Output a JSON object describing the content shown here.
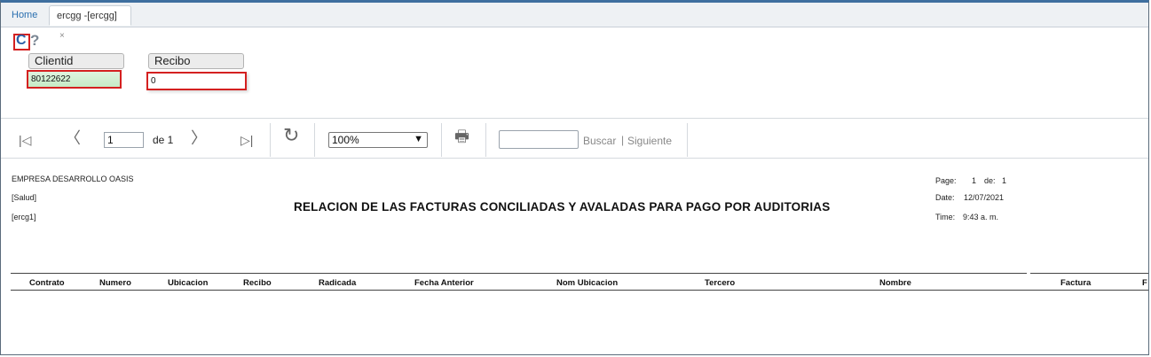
{
  "tabs": {
    "home": "Home",
    "active": "ercgg -[ercgg]",
    "close": "×"
  },
  "icons": {
    "refresh": "refresh-icon",
    "help": "help-icon"
  },
  "params": {
    "clientid_label": "Clientid",
    "clientid_value": "80122622",
    "recibo_label": "Recibo",
    "recibo_value": "0"
  },
  "toolbar": {
    "first": "|◁",
    "prev": "〈",
    "page_value": "1",
    "page_of": "de 1",
    "next": "〉",
    "last": "▷|",
    "refresh": "↻",
    "zoom": "100%",
    "print": "🖶",
    "search_label": "Buscar",
    "separator": "|",
    "next_label": "Siguiente"
  },
  "report": {
    "company": "EMPRESA DESARROLLO OASIS",
    "line2": "[Salud]",
    "line3": "[ercg1]",
    "title": "RELACION DE LAS FACTURAS CONCILIADAS Y AVALADAS PARA PAGO POR AUDITORIAS",
    "page_label": "Page:",
    "page_num": "1",
    "de_label": "de:",
    "page_total": "1",
    "date_label": "Date:",
    "date_value": "12/07/2021",
    "time_label": "Time:",
    "time_value": "9:43 a. m.",
    "columns": [
      "Contrato",
      "Numero",
      "Ubicacion",
      "Recibo",
      "Radicada",
      "Fecha Anterior",
      "Nom Ubicacion",
      "Tercero",
      "Nombre",
      "Factura",
      "F"
    ]
  },
  "colors": {
    "accent": "#d42020",
    "brand": "#2b5fa6"
  }
}
